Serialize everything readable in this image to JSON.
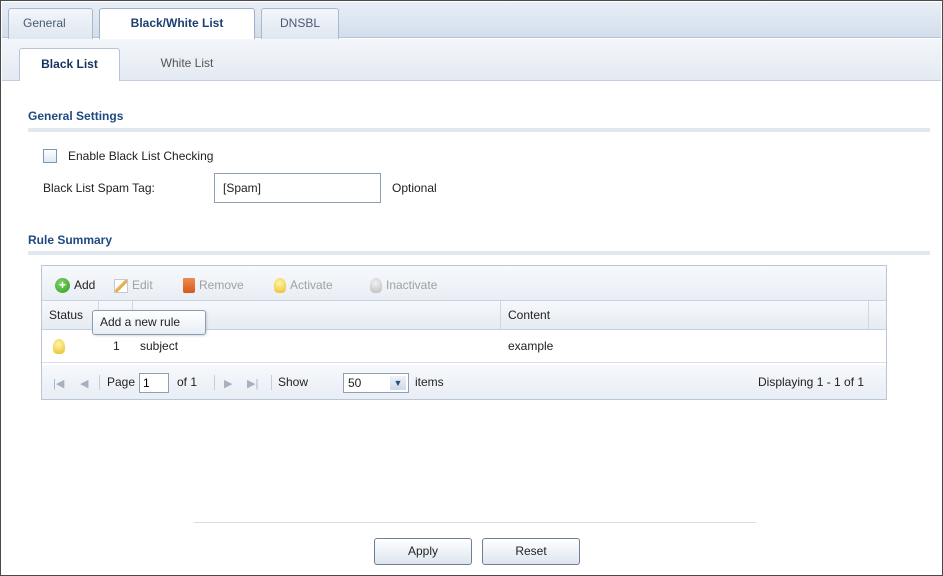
{
  "top_tabs": [
    "General",
    "Black/White List",
    "DNSBL"
  ],
  "sub_tabs": [
    "Black List",
    "White List"
  ],
  "general_settings": {
    "title": "General Settings",
    "enable_checkbox_label": "Enable Black List Checking",
    "spam_tag_label": "Black List Spam Tag:",
    "spam_tag_value": "[Spam]",
    "optional_note": "Optional"
  },
  "rule_summary": {
    "title": "Rule Summary",
    "toolbar": {
      "add": "Add",
      "edit": "Edit",
      "remove": "Remove",
      "activate": "Activate",
      "inactivate": "Inactivate"
    },
    "tooltip": "Add a new rule",
    "columns": [
      "Status",
      "",
      "",
      "Content"
    ],
    "rows": [
      {
        "index": "1",
        "type": "subject",
        "content": "example",
        "status_icon": "bulb-on-icon"
      }
    ],
    "pager": {
      "page_label": "Page",
      "page_value": "1",
      "of_label": "of 1",
      "show_label": "Show",
      "show_value": "50",
      "items_label": "items",
      "displaying": "Displaying 1 - 1 of 1"
    }
  },
  "buttons": {
    "apply": "Apply",
    "reset": "Reset"
  },
  "colors": {
    "accent_title": "#1f4a80",
    "tab_bar": "#d3deec"
  }
}
